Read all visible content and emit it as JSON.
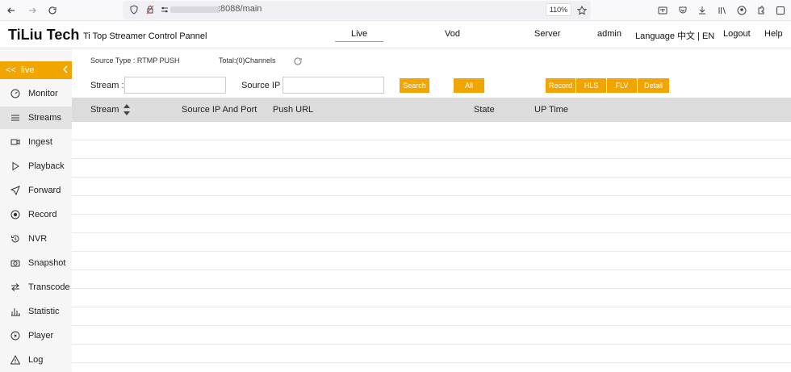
{
  "browser": {
    "url_suffix": ":8088/main",
    "zoom": "110%"
  },
  "header": {
    "brand": "TiLiu Tech",
    "subtitle": "Ti Top Streamer Control Pannel",
    "nav": {
      "live": "Live",
      "vod": "Vod",
      "server": "Server",
      "admin": "admin",
      "language": "Language 中文 | EN",
      "logout": "Logout",
      "help": "Help"
    }
  },
  "sidebar": {
    "section_label": "<<  live",
    "items": [
      {
        "label": "Monitor",
        "icon": "gauge-icon"
      },
      {
        "label": "Streams",
        "icon": "list-icon"
      },
      {
        "label": "Ingest",
        "icon": "video-camera-icon"
      },
      {
        "label": "Playback",
        "icon": "play-icon"
      },
      {
        "label": "Forward",
        "icon": "send-icon"
      },
      {
        "label": "Record",
        "icon": "record-icon"
      },
      {
        "label": "NVR",
        "icon": "history-icon"
      },
      {
        "label": "Snapshot",
        "icon": "camera-icon"
      },
      {
        "label": "Transcode",
        "icon": "swap-icon"
      },
      {
        "label": "Statistic",
        "icon": "bar-chart-icon"
      },
      {
        "label": "Player",
        "icon": "play-circle-icon"
      },
      {
        "label": "Log",
        "icon": "warning-icon"
      }
    ]
  },
  "main": {
    "source_type": "Source Type : RTMP PUSH",
    "total": "Total:(0)Channels",
    "stream_label": "Stream :",
    "source_ip_label": "Source IP :",
    "stream_value": "",
    "source_ip_value": "",
    "buttons": {
      "search": "Search",
      "all": "All",
      "record": "Record",
      "hls": "HLS",
      "flv": "FLV",
      "detail": "Detail"
    },
    "table": {
      "columns": [
        "Stream",
        "Source IP And Port",
        "Push URL",
        "State",
        "UP Time"
      ]
    }
  },
  "colors": {
    "accent": "#f0a500",
    "sidebar_bg": "#f6f6f6",
    "table_head_bg": "#dcdcdc"
  }
}
